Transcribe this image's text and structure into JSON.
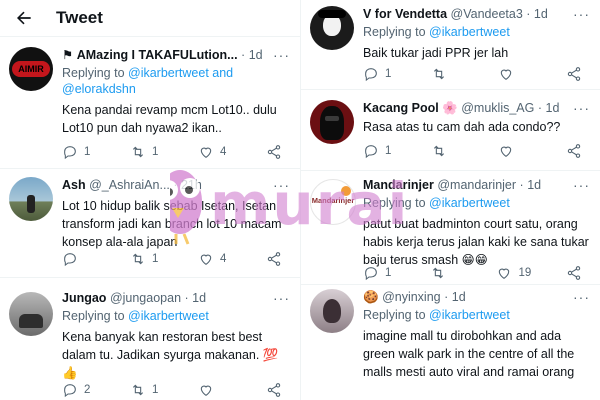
{
  "header": {
    "title": "Tweet"
  },
  "left": [
    {
      "name": "AMazing I TAKAFULution...",
      "handle": "",
      "time": "1d",
      "reply_prefix": "Replying to ",
      "reply_to": "@ikarbertweet and @elorakdshn",
      "text": "Kena pandai revamp mcm Lot10.. dulu Lot10 pun dah nyawa2 ikan..",
      "counts": {
        "reply": "1",
        "retweet": "1",
        "like": "4"
      }
    },
    {
      "name": "Ash",
      "handle": "@_AshraiAn...",
      "time": "21h",
      "reply_prefix": "",
      "reply_to": "",
      "text": "Lot 10 hidup balik sebab Isetan, Isetan transform jadi kan branch lot 10 macam konsep ala-ala japan",
      "counts": {
        "reply": "",
        "retweet": "1",
        "like": "4"
      }
    },
    {
      "name": "Jungao",
      "handle": "@jungaopan",
      "time": "1d",
      "reply_prefix": "Replying to ",
      "reply_to": "@ikarbertweet",
      "text": "Kena banyak kan restoran best best dalam tu. Jadikan syurga makanan. 💯 👍",
      "counts": {
        "reply": "2",
        "retweet": "1",
        "like": ""
      }
    }
  ],
  "right": [
    {
      "name": "V for Vendetta",
      "handle": "@Vandeeta3",
      "time": "1d",
      "reply_prefix": "Replying to ",
      "reply_to": "@ikarbertweet",
      "text": "Baik tukar jadi PPR jer lah",
      "counts": {
        "reply": "1",
        "retweet": "",
        "like": ""
      }
    },
    {
      "name": "Kacang Pool 🌸",
      "handle": "@muklis_AG",
      "time": "1d",
      "reply_prefix": "Replying to ",
      "reply_to": "@ikarbertweet",
      "text": "Rasa atas tu cam dah ada condo??",
      "counts": {
        "reply": "1",
        "retweet": "",
        "like": ""
      }
    },
    {
      "name": "Mandarinjer",
      "handle": "@mandarinjer",
      "time": "1d",
      "reply_prefix": "Replying to ",
      "reply_to": "@ikarbertweet",
      "text": "patut buat badminton court satu, orang habis kerja terus jalan kaki ke sana tukar baju terus smash 😁😁",
      "counts": {
        "reply": "1",
        "retweet": "",
        "like": "19"
      }
    },
    {
      "name": "🍪",
      "handle": "@nyinxing",
      "time": "1d",
      "reply_prefix": "Replying to ",
      "reply_to": "@ikarbertweet",
      "text": "imagine mall tu dirobohkan and ada green walk park in the centre of all the malls mesti auto viral and ramai orang",
      "counts": {
        "reply": "",
        "retweet": "",
        "like": ""
      }
    }
  ],
  "avatars": {
    "left0_label": "AIMIR",
    "right2_label": "Mandarinjer"
  },
  "watermark": {
    "text": "murai"
  },
  "colors": {
    "link": "#1d9bf0",
    "muted": "#536471",
    "text": "#0f1419",
    "border": "#eff3f4",
    "watermark": "#d27fd0"
  }
}
